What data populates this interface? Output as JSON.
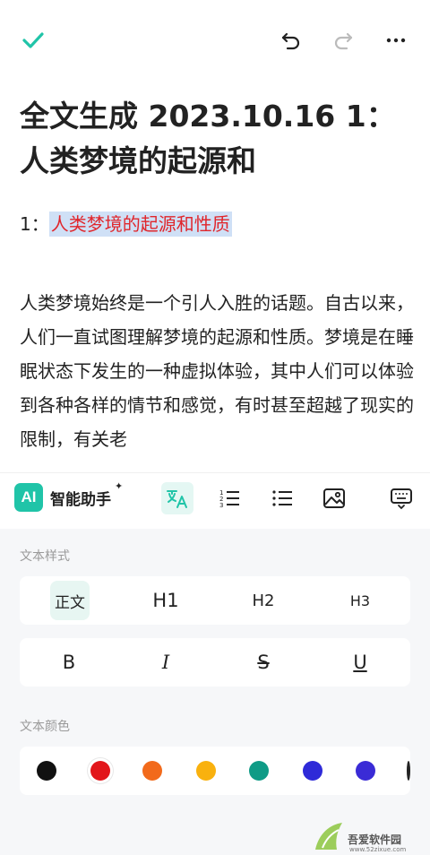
{
  "doc": {
    "title": "全文生成 2023.10.16 1：人类梦境的起源和",
    "subheading_prefix": "1：",
    "subheading_highlight": "人类梦境的起源和性质",
    "body": "人类梦境始终是一个引人入胜的话题。自古以来，人们一直试图理解梦境的起源和性质。梦境是在睡眠状态下发生的一种虚拟体验，其中人们可以体验到各种各样的情节和感觉，有时甚至超越了现实的限制，有关老"
  },
  "toolbar": {
    "ai_badge": "AI",
    "ai_label": "智能助手",
    "ai_star": "✦"
  },
  "panel": {
    "style_label": "文本样式",
    "color_label": "文本颜色",
    "heading_options": [
      "正文",
      "H1",
      "H2",
      "H3"
    ],
    "format_options": [
      "B",
      "I",
      "S",
      "U"
    ]
  },
  "colors": {
    "accent": "#20c4a8",
    "highlight_bg": "#cfe0f6",
    "highlight_text": "#e0262c",
    "swatches": [
      "#111111",
      "#e2161a",
      "#f26a1b",
      "#f9b10e",
      "#0f9b86",
      "#2e2ad8",
      "#3a2bd6"
    ]
  },
  "watermark": {
    "text": "吾爱软件园",
    "url": "www.52zixue.com"
  }
}
